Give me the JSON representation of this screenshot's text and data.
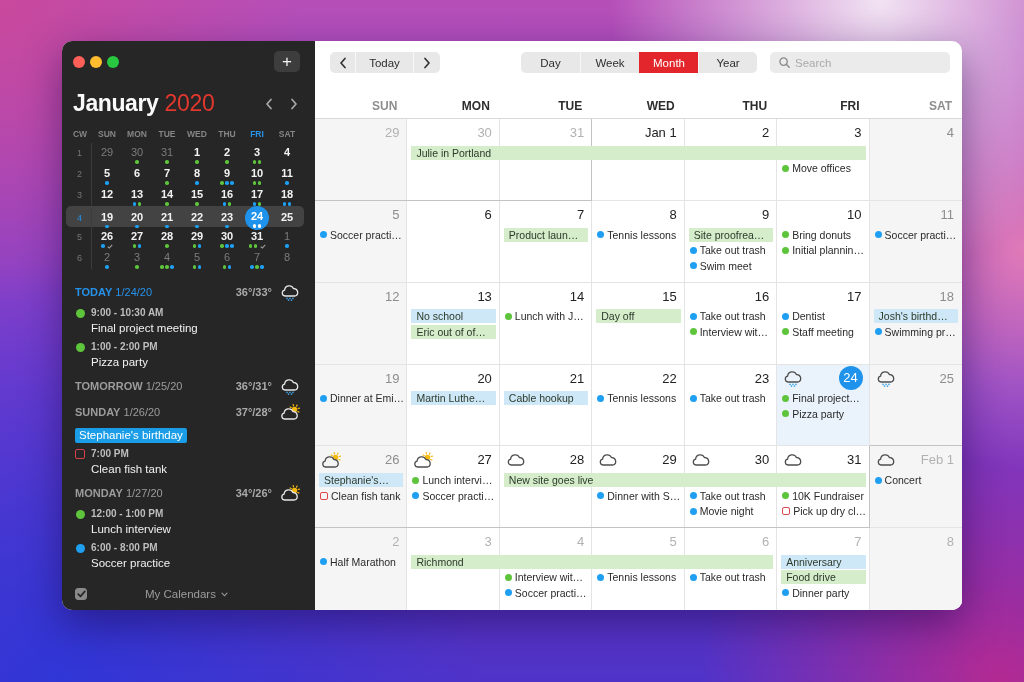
{
  "sidebar": {
    "add_button": "+",
    "month": "January",
    "year": "2020",
    "mini_calendar": {
      "headers": [
        {
          "label": "CW",
          "today": false
        },
        {
          "label": "SUN",
          "today": false
        },
        {
          "label": "MON",
          "today": false
        },
        {
          "label": "TUE",
          "today": false
        },
        {
          "label": "WED",
          "today": false
        },
        {
          "label": "THU",
          "today": false
        },
        {
          "label": "FRI",
          "today": true
        },
        {
          "label": "SAT",
          "today": false
        }
      ],
      "weeks": [
        {
          "cw": "1",
          "selected": false,
          "days": [
            {
              "d": "29",
              "kind": "outside",
              "task": false
            },
            {
              "d": "30",
              "kind": "outside",
              "task": false,
              "dots": [
                {
                  "color": "#5ec43c"
                }
              ]
            },
            {
              "d": "31",
              "kind": "outside",
              "task": false,
              "dots": [
                {
                  "color": "#5ec43c"
                }
              ]
            },
            {
              "d": "1",
              "kind": "inside",
              "task": false,
              "dots": [
                {
                  "color": "#5ec43c"
                }
              ]
            },
            {
              "d": "2",
              "kind": "inside",
              "task": false,
              "dots": [
                {
                  "color": "#5ec43c"
                }
              ]
            },
            {
              "d": "3",
              "kind": "inside",
              "task": false,
              "dots": [
                {
                  "color": "#5ec43c"
                },
                {
                  "color": "#5ec43c"
                }
              ]
            },
            {
              "d": "4",
              "kind": "inside",
              "task": false
            }
          ]
        },
        {
          "cw": "2",
          "selected": false,
          "days": [
            {
              "d": "5",
              "kind": "inside",
              "task": false,
              "dots": [
                {
                  "color": "#1f9ff2"
                }
              ]
            },
            {
              "d": "6",
              "kind": "inside",
              "task": false
            },
            {
              "d": "7",
              "kind": "inside",
              "task": false,
              "dots": [
                {
                  "color": "#5ec43c"
                }
              ]
            },
            {
              "d": "8",
              "kind": "inside",
              "task": false,
              "dots": [
                {
                  "color": "#1f9ff2"
                }
              ]
            },
            {
              "d": "9",
              "kind": "inside",
              "task": false,
              "dots": [
                {
                  "color": "#5ec43c"
                },
                {
                  "color": "#1f9ff2"
                },
                {
                  "color": "#1f9ff2"
                }
              ]
            },
            {
              "d": "10",
              "kind": "inside",
              "task": false,
              "dots": [
                {
                  "color": "#5ec43c"
                },
                {
                  "color": "#5ec43c"
                }
              ]
            },
            {
              "d": "11",
              "kind": "inside",
              "task": false,
              "dots": [
                {
                  "color": "#1f9ff2"
                }
              ]
            }
          ]
        },
        {
          "cw": "3",
          "selected": false,
          "days": [
            {
              "d": "12",
              "kind": "inside",
              "task": false
            },
            {
              "d": "13",
              "kind": "inside",
              "task": false,
              "dots": [
                {
                  "color": "#1f9ff2"
                },
                {
                  "color": "#5ec43c"
                }
              ]
            },
            {
              "d": "14",
              "kind": "inside",
              "task": false,
              "dots": [
                {
                  "color": "#5ec43c"
                }
              ]
            },
            {
              "d": "15",
              "kind": "inside",
              "task": false,
              "dots": [
                {
                  "color": "#5ec43c"
                }
              ]
            },
            {
              "d": "16",
              "kind": "inside",
              "task": false,
              "dots": [
                {
                  "color": "#1f9ff2"
                },
                {
                  "color": "#5ec43c"
                }
              ]
            },
            {
              "d": "17",
              "kind": "inside",
              "task": false,
              "dots": [
                {
                  "color": "#1f9ff2"
                },
                {
                  "color": "#5ec43c"
                }
              ]
            },
            {
              "d": "18",
              "kind": "inside",
              "task": false,
              "dots": [
                {
                  "color": "#1f9ff2"
                },
                {
                  "color": "#1f9ff2"
                }
              ]
            }
          ]
        },
        {
          "cw": "4",
          "selected": true,
          "days": [
            {
              "d": "19",
              "kind": "inside",
              "task": false,
              "dots": [
                {
                  "color": "#1f9ff2"
                }
              ]
            },
            {
              "d": "20",
              "kind": "inside",
              "task": false,
              "dots": [
                {
                  "color": "#1f9ff2"
                }
              ]
            },
            {
              "d": "21",
              "kind": "inside",
              "task": false,
              "dots": [
                {
                  "color": "#1f9ff2"
                }
              ]
            },
            {
              "d": "22",
              "kind": "inside",
              "task": false,
              "dots": [
                {
                  "color": "#1f9ff2"
                }
              ]
            },
            {
              "d": "23",
              "kind": "inside",
              "task": false,
              "dots": [
                {
                  "color": "#1f9ff2"
                }
              ]
            },
            {
              "d": "24",
              "kind": "today",
              "task": false,
              "dots": [
                {
                  "color": "#ffffff"
                },
                {
                  "color": "#ffffff"
                }
              ]
            },
            {
              "d": "25",
              "kind": "inside",
              "task": false
            }
          ]
        },
        {
          "cw": "5",
          "selected": false,
          "days": [
            {
              "d": "26",
              "kind": "inside",
              "task": true,
              "dots": [
                {
                  "color": "#1f9ff2"
                }
              ]
            },
            {
              "d": "27",
              "kind": "inside",
              "task": false,
              "dots": [
                {
                  "color": "#5ec43c"
                },
                {
                  "color": "#1f9ff2"
                }
              ]
            },
            {
              "d": "28",
              "kind": "inside",
              "task": false,
              "dots": [
                {
                  "color": "#5ec43c"
                }
              ]
            },
            {
              "d": "29",
              "kind": "inside",
              "task": false,
              "dots": [
                {
                  "color": "#5ec43c"
                },
                {
                  "color": "#1f9ff2"
                }
              ]
            },
            {
              "d": "30",
              "kind": "inside",
              "task": false,
              "dots": [
                {
                  "color": "#5ec43c"
                },
                {
                  "color": "#1f9ff2"
                },
                {
                  "color": "#1f9ff2"
                }
              ]
            },
            {
              "d": "31",
              "kind": "inside",
              "task": true,
              "dots": [
                {
                  "color": "#5ec43c"
                },
                {
                  "color": "#5ec43c"
                }
              ]
            },
            {
              "d": "1",
              "kind": "outside",
              "task": false,
              "dots": [
                {
                  "color": "#1f9ff2"
                }
              ]
            }
          ]
        },
        {
          "cw": "6",
          "selected": false,
          "days": [
            {
              "d": "2",
              "kind": "outside",
              "task": false,
              "dots": [
                {
                  "color": "#1f9ff2"
                }
              ]
            },
            {
              "d": "3",
              "kind": "outside",
              "task": false,
              "dots": [
                {
                  "color": "#5ec43c"
                }
              ]
            },
            {
              "d": "4",
              "kind": "outside",
              "task": false,
              "dots": [
                {
                  "color": "#5ec43c"
                },
                {
                  "color": "#5ec43c"
                },
                {
                  "color": "#1f9ff2"
                }
              ]
            },
            {
              "d": "5",
              "kind": "outside",
              "task": false,
              "dots": [
                {
                  "color": "#5ec43c"
                },
                {
                  "color": "#1f9ff2"
                }
              ]
            },
            {
              "d": "6",
              "kind": "outside",
              "task": false,
              "dots": [
                {
                  "color": "#5ec43c"
                },
                {
                  "color": "#1f9ff2"
                }
              ]
            },
            {
              "d": "7",
              "kind": "outside",
              "task": false,
              "dots": [
                {
                  "color": "#1f9ff2"
                },
                {
                  "color": "#5ec43c"
                },
                {
                  "color": "#1f9ff2"
                }
              ]
            },
            {
              "d": "8",
              "kind": "outside",
              "task": false
            }
          ]
        }
      ]
    },
    "agenda": [
      {
        "title": "**TODAY** 1/24/20",
        "today": true,
        "temp": "36°/33°",
        "weather": {
          "kind": "rain"
        },
        "items": [
          {
            "kind": "event",
            "color": "#5ec43c",
            "time": "9:00 - 10:30 AM",
            "title": "Final project meeting"
          },
          {
            "kind": "event",
            "color": "#5ec43c",
            "time": "1:00 - 2:00 PM",
            "title": "Pizza party"
          }
        ]
      },
      {
        "title": "**TOMORROW** 1/25/20",
        "today": false,
        "temp": "36°/31°",
        "weather": {
          "kind": "rain"
        }
      },
      {
        "title": "**SUNDAY** 1/26/20",
        "today": false,
        "temp": "37°/28°",
        "weather": {
          "kind": "sun-cloud"
        },
        "items": [
          {
            "kind": "allday",
            "color": "#1a9de6",
            "title": "Stephanie's birthday"
          },
          {
            "kind": "task",
            "color": "#d8434b",
            "time": "7:00 PM",
            "title": "Clean fish tank"
          }
        ]
      },
      {
        "title": "**MONDAY** 1/27/20",
        "today": false,
        "temp": "34°/26°",
        "weather": {
          "kind": "sun-cloud"
        },
        "items": [
          {
            "kind": "event",
            "color": "#5ec43c",
            "time": "12:00 - 1:00 PM",
            "title": "Lunch interview"
          },
          {
            "kind": "event",
            "color": "#1f9ff2",
            "time": "6:00 - 8:00 PM",
            "title": "Soccer practice"
          }
        ]
      }
    ],
    "footer": {
      "checked": true,
      "label": "My Calendars"
    }
  },
  "toolbar": {
    "today_button": "Today",
    "views": [
      {
        "label": "Day",
        "selected": false
      },
      {
        "label": "Week",
        "selected": false
      },
      {
        "label": "Month",
        "selected": true
      },
      {
        "label": "Year",
        "selected": false
      }
    ],
    "search": {
      "placeholder": "Search"
    }
  },
  "month_view": {
    "columns": [
      {
        "label": "SUN",
        "weekend": true
      },
      {
        "label": "MON",
        "weekend": false
      },
      {
        "label": "TUE",
        "weekend": false
      },
      {
        "label": "WED",
        "weekend": false
      },
      {
        "label": "THU",
        "weekend": false
      },
      {
        "label": "FRI",
        "weekend": false
      },
      {
        "label": "SAT",
        "weekend": true
      }
    ],
    "weeks": [
      {
        "days": [
          {
            "date": "29",
            "kind": "outside"
          },
          {
            "date": "30",
            "kind": "outside",
            "events": [
              {
                "kind": "span",
                "color": "#d5edcb",
                "title": "Julie in Portland"
              }
            ]
          },
          {
            "date": "31",
            "kind": "outside",
            "events": [
              {
                "kind": "continued"
              }
            ]
          },
          {
            "date": "Jan 1",
            "kind": "inside",
            "events": [
              {
                "kind": "continued"
              }
            ]
          },
          {
            "date": "2",
            "kind": "inside",
            "events": [
              {
                "kind": "continued"
              }
            ]
          },
          {
            "date": "3",
            "kind": "inside",
            "events": [
              {
                "kind": "continued"
              },
              {
                "kind": "dot",
                "color": "#5ec43c",
                "title": "Move offices"
              }
            ]
          },
          {
            "date": "4",
            "kind": "inside"
          }
        ]
      },
      {
        "days": [
          {
            "date": "5",
            "kind": "inside",
            "events": [
              {
                "kind": "dot",
                "color": "#1f9ff2",
                "title": "Soccer practi…"
              }
            ]
          },
          {
            "date": "6",
            "kind": "inside"
          },
          {
            "date": "7",
            "kind": "inside",
            "events": [
              {
                "kind": "allday",
                "color": "#d5edcb",
                "title": "Product laun…"
              }
            ]
          },
          {
            "date": "8",
            "kind": "inside",
            "events": [
              {
                "kind": "dot",
                "color": "#1f9ff2",
                "title": "Tennis lessons"
              }
            ]
          },
          {
            "date": "9",
            "kind": "inside",
            "events": [
              {
                "kind": "allday",
                "color": "#d5edcb",
                "title": "Site proofrea…"
              },
              {
                "kind": "dot",
                "color": "#1f9ff2",
                "title": "Take out trash"
              },
              {
                "kind": "dot",
                "color": "#1f9ff2",
                "title": "Swim meet"
              }
            ]
          },
          {
            "date": "10",
            "kind": "inside",
            "events": [
              {
                "kind": "dot",
                "color": "#5ec43c",
                "title": "Bring donuts"
              },
              {
                "kind": "dot",
                "color": "#5ec43c",
                "title": "Initial plannin…"
              }
            ]
          },
          {
            "date": "11",
            "kind": "inside",
            "events": [
              {
                "kind": "dot",
                "color": "#1f9ff2",
                "title": "Soccer practi…"
              }
            ]
          }
        ]
      },
      {
        "days": [
          {
            "date": "12",
            "kind": "inside"
          },
          {
            "date": "13",
            "kind": "inside",
            "events": [
              {
                "kind": "allday",
                "color": "#cfe8f8",
                "title": "No school"
              },
              {
                "kind": "allday",
                "color": "#d5edcb",
                "title": "Eric out of of…"
              }
            ]
          },
          {
            "date": "14",
            "kind": "inside",
            "events": [
              {
                "kind": "dot",
                "color": "#5ec43c",
                "title": "Lunch with J…"
              }
            ]
          },
          {
            "date": "15",
            "kind": "inside",
            "events": [
              {
                "kind": "allday",
                "color": "#d5edcb",
                "title": "Day off"
              }
            ]
          },
          {
            "date": "16",
            "kind": "inside",
            "events": [
              {
                "kind": "dot",
                "color": "#1f9ff2",
                "title": "Take out trash"
              },
              {
                "kind": "dot",
                "color": "#5ec43c",
                "title": "Interview wit…"
              }
            ]
          },
          {
            "date": "17",
            "kind": "inside",
            "events": [
              {
                "kind": "dot",
                "color": "#1f9ff2",
                "title": "Dentist"
              },
              {
                "kind": "dot",
                "color": "#5ec43c",
                "title": "Staff meeting"
              }
            ]
          },
          {
            "date": "18",
            "kind": "inside",
            "events": [
              {
                "kind": "allday",
                "color": "#cfe8f8",
                "title": "Josh's birthd…"
              },
              {
                "kind": "dot",
                "color": "#1f9ff2",
                "title": "Swimming pr…"
              }
            ]
          }
        ]
      },
      {
        "days": [
          {
            "date": "19",
            "kind": "inside",
            "events": [
              {
                "kind": "dot",
                "color": "#1f9ff2",
                "title": "Dinner at Emi…"
              }
            ]
          },
          {
            "date": "20",
            "kind": "inside",
            "events": [
              {
                "kind": "allday",
                "color": "#cfe8f8",
                "title": "Martin Luthe…"
              }
            ]
          },
          {
            "date": "21",
            "kind": "inside",
            "events": [
              {
                "kind": "allday",
                "color": "#cfe8f8",
                "title": "Cable hookup"
              }
            ]
          },
          {
            "date": "22",
            "kind": "inside",
            "events": [
              {
                "kind": "dot",
                "color": "#1f9ff2",
                "title": "Tennis lessons"
              }
            ]
          },
          {
            "date": "23",
            "kind": "inside",
            "events": [
              {
                "kind": "dot",
                "color": "#1f9ff2",
                "title": "Take out trash"
              }
            ]
          },
          {
            "date": "24",
            "kind": "today",
            "weather": {
              "kind": "rain"
            },
            "events": [
              {
                "kind": "dot",
                "color": "#5ec43c",
                "title": "Final project…"
              },
              {
                "kind": "dot",
                "color": "#5ec43c",
                "title": "Pizza party"
              }
            ]
          },
          {
            "date": "25",
            "kind": "inside",
            "weather": {
              "kind": "rain"
            }
          }
        ]
      },
      {
        "days": [
          {
            "date": "26",
            "kind": "inside",
            "weather": {
              "kind": "sun-cloud"
            },
            "events": [
              {
                "kind": "allday",
                "color": "#cfe8f8",
                "title": "Stephanie's…"
              },
              {
                "kind": "task",
                "color": "#e0454b",
                "title": "Clean fish tank"
              }
            ]
          },
          {
            "date": "27",
            "kind": "inside",
            "weather": {
              "kind": "sun-cloud"
            },
            "events": [
              {
                "kind": "dot",
                "color": "#5ec43c",
                "title": "Lunch intervi…"
              },
              {
                "kind": "dot",
                "color": "#1f9ff2",
                "title": "Soccer practi…"
              }
            ]
          },
          {
            "date": "28",
            "kind": "inside",
            "weather": {
              "kind": "cloud"
            },
            "events": [
              {
                "kind": "span",
                "color": "#d5edcb",
                "title": "New site goes live"
              }
            ]
          },
          {
            "date": "29",
            "kind": "inside",
            "weather": {
              "kind": "cloud"
            },
            "events": [
              {
                "kind": "continued"
              },
              {
                "kind": "dot",
                "color": "#1f9ff2",
                "title": "Dinner with S…"
              }
            ]
          },
          {
            "date": "30",
            "kind": "inside",
            "weather": {
              "kind": "cloud"
            },
            "events": [
              {
                "kind": "continued"
              },
              {
                "kind": "dot",
                "color": "#1f9ff2",
                "title": "Take out trash"
              },
              {
                "kind": "dot",
                "color": "#1f9ff2",
                "title": "Movie night"
              }
            ]
          },
          {
            "date": "31",
            "kind": "inside",
            "weather": {
              "kind": "cloud"
            },
            "events": [
              {
                "kind": "continued"
              },
              {
                "kind": "dot",
                "color": "#5ec43c",
                "title": "10K Fundraiser"
              },
              {
                "kind": "task",
                "color": "#e0454b",
                "title": "Pick up dry cl…"
              }
            ]
          },
          {
            "date": "Feb 1",
            "kind": "outside",
            "weather": {
              "kind": "cloud"
            },
            "events": [
              {
                "kind": "dot",
                "color": "#1f9ff2",
                "title": "Concert"
              }
            ]
          }
        ]
      },
      {
        "days": [
          {
            "date": "2",
            "kind": "outside",
            "events": [
              {
                "kind": "dot",
                "color": "#1f9ff2",
                "title": "Half Marathon"
              }
            ]
          },
          {
            "date": "3",
            "kind": "outside",
            "events": [
              {
                "kind": "span",
                "color": "#d5edcb",
                "title": "Richmond"
              }
            ]
          },
          {
            "date": "4",
            "kind": "outside",
            "events": [
              {
                "kind": "continued"
              },
              {
                "kind": "dot",
                "color": "#5ec43c",
                "title": "Interview wit…"
              },
              {
                "kind": "dot",
                "color": "#1f9ff2",
                "title": "Soccer practi…"
              }
            ]
          },
          {
            "date": "5",
            "kind": "outside",
            "events": [
              {
                "kind": "continued"
              },
              {
                "kind": "dot",
                "color": "#1f9ff2",
                "title": "Tennis lessons"
              }
            ]
          },
          {
            "date": "6",
            "kind": "outside",
            "events": [
              {
                "kind": "continued"
              },
              {
                "kind": "dot",
                "color": "#1f9ff2",
                "title": "Take out trash"
              }
            ]
          },
          {
            "date": "7",
            "kind": "outside",
            "events": [
              {
                "kind": "allday",
                "color": "#cfe8f8",
                "title": "Anniversary"
              },
              {
                "kind": "allday",
                "color": "#d5edcb",
                "title": "Food drive"
              },
              {
                "kind": "dot",
                "color": "#1f9ff2",
                "title": "Dinner party"
              }
            ]
          },
          {
            "date": "8",
            "kind": "outside"
          }
        ]
      }
    ]
  }
}
